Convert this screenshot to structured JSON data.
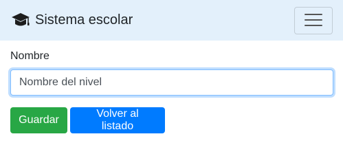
{
  "navbar": {
    "brand_icon": "graduation-cap-icon",
    "brand_title": "Sistema escolar",
    "toggle_icon": "hamburger-menu-icon",
    "background": "#e3f0fb"
  },
  "form": {
    "name_label": "Nombre",
    "name_input": {
      "value": "",
      "placeholder": "Nombre del nivel"
    },
    "save_button": "Guardar",
    "back_button": "Volver al listado"
  },
  "colors": {
    "save": "#28a745",
    "back": "#007bff",
    "focus_border": "#80bdff"
  }
}
